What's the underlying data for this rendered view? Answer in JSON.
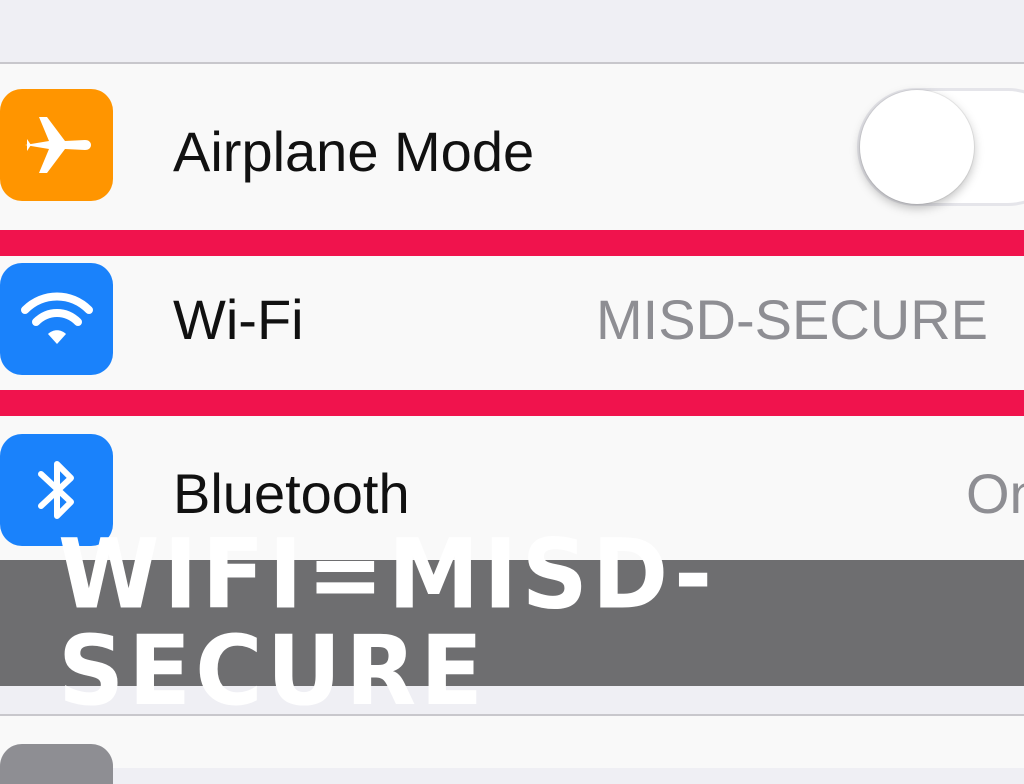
{
  "settings": {
    "rows": [
      {
        "label": "Airplane Mode",
        "icon": "airplane-icon",
        "icon_color": "#ff9500",
        "toggle_on": false
      },
      {
        "label": "Wi-Fi",
        "value": "MISD-SECURE",
        "icon": "wifi-icon",
        "icon_color": "#1a82fb"
      },
      {
        "label": "Bluetooth",
        "value": "On",
        "icon": "bluetooth-icon",
        "icon_color": "#1a82fb"
      }
    ]
  },
  "banner": {
    "text": "WIFI=MISD-SECURE",
    "color": "#6e6e70"
  },
  "highlight_color": "#f0134d"
}
